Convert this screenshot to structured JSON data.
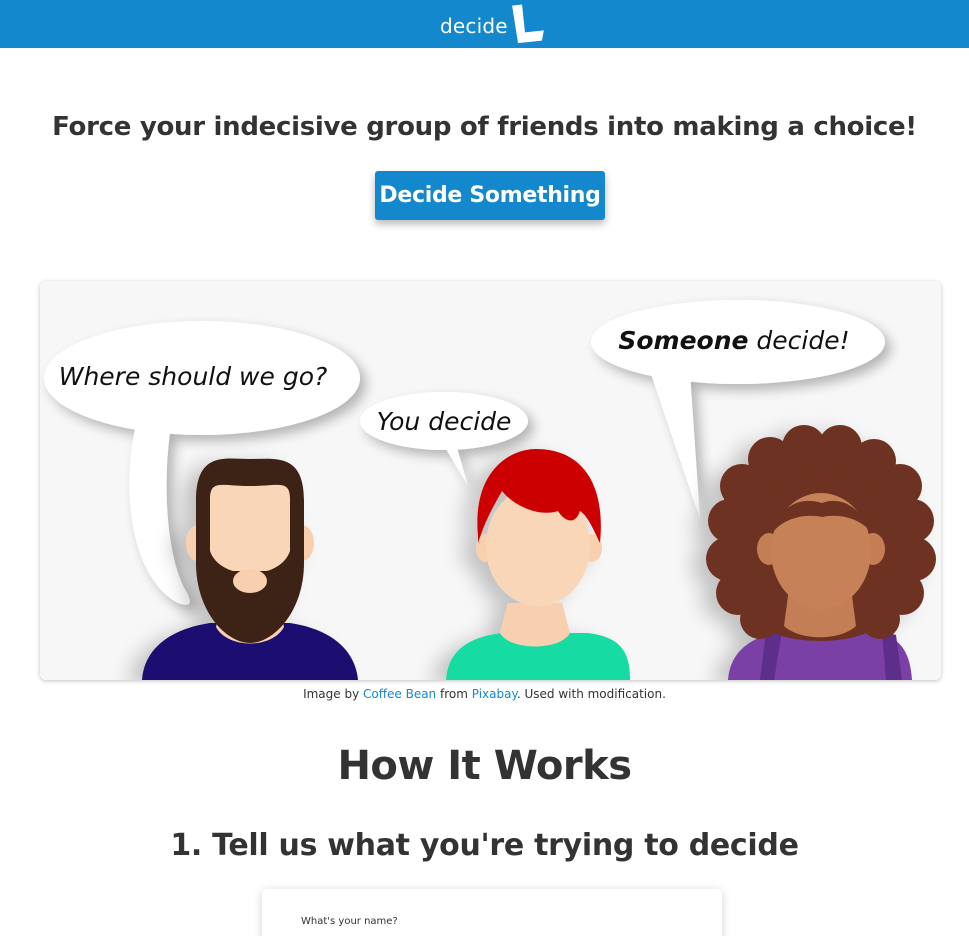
{
  "brand": {
    "name": "decide",
    "logo_letter": "L"
  },
  "hero": {
    "tagline": "Force your indecisive group of friends into making a choice!",
    "cta_label": "Decide Something"
  },
  "illustration": {
    "bubble_1": "Where should we go?",
    "bubble_2": "You decide",
    "bubble_3_bold": "Someone",
    "bubble_3_rest": " decide!"
  },
  "credit": {
    "prefix": "Image by ",
    "author": "Coffee Bean",
    "middle": " from ",
    "source": "Pixabay",
    "suffix": ". Used with modification."
  },
  "how_it_works": {
    "title": "How It Works",
    "step_1_number": "1.",
    "step_1_text": " Tell us what you're trying to decide",
    "card_label": "What's your name?"
  },
  "colors": {
    "brand_blue": "#1488cc",
    "text": "#333333",
    "shirt_1": "#1f0f6f",
    "shirt_2": "#12dca3",
    "shirt_3": "#7a3fa6",
    "hair_1": "#3e2418",
    "hair_2": "#cc0000",
    "hair_3": "#6e3220"
  }
}
